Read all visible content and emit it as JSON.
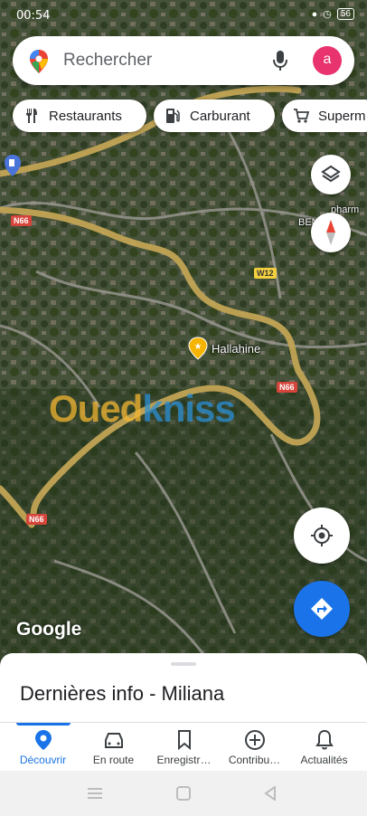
{
  "status": {
    "time": "00:54",
    "battery": "56"
  },
  "search": {
    "placeholder": "Rechercher",
    "avatar_letter": "a"
  },
  "chips": [
    {
      "label": "Restaurants",
      "icon": "fork-knife-icon"
    },
    {
      "label": "Carburant",
      "icon": "gas-station-icon"
    },
    {
      "label": "Superm",
      "icon": "cart-icon"
    }
  ],
  "map": {
    "labels": {
      "place": "Hallahine",
      "pharm": "pharm",
      "beni": "BENI OJA"
    },
    "roads": [
      "N66",
      "W12",
      "N66",
      "N66"
    ],
    "google": "Google",
    "watermark_a": "Oued",
    "watermark_b": "kniss"
  },
  "sheet": {
    "title": "Dernières info - Miliana"
  },
  "nav": [
    {
      "label": "Découvrir",
      "icon": "explore-pin-icon",
      "active": true
    },
    {
      "label": "En route",
      "icon": "car-icon"
    },
    {
      "label": "Enregistr…",
      "icon": "bookmark-icon"
    },
    {
      "label": "Contribu…",
      "icon": "add-circle-icon"
    },
    {
      "label": "Actualités",
      "icon": "bell-icon"
    }
  ],
  "colors": {
    "accent": "#1a73e8",
    "avatar": "#e8336e",
    "road": "#c2a455"
  }
}
